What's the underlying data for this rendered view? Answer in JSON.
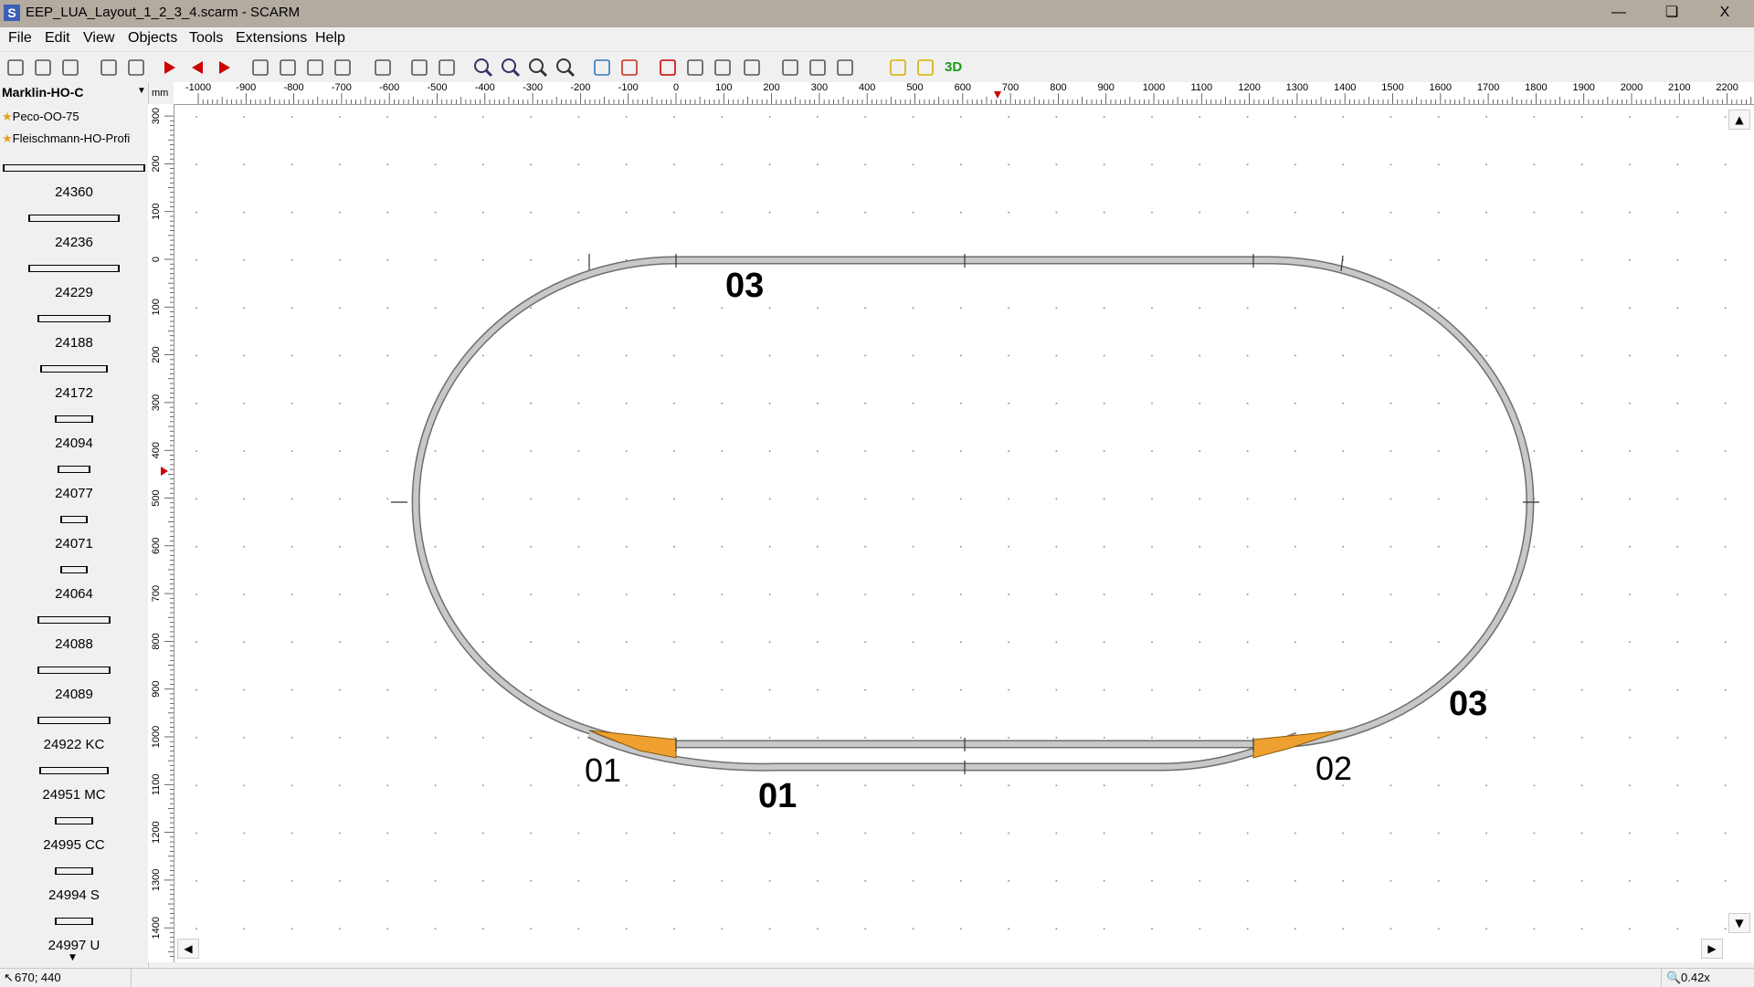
{
  "window": {
    "title": "EEP_LUA_Layout_1_2_3_4.scarm - SCARM",
    "app_icon": "S",
    "minimize": "—",
    "restore": "❏",
    "close": "X"
  },
  "menu": [
    "File",
    "Edit",
    "View",
    "Objects",
    "Tools",
    "Extensions",
    "Help"
  ],
  "toolbar": {
    "icons": [
      "new-file",
      "open-folder",
      "save",
      "print",
      "print-preview",
      "run-forward",
      "run-back",
      "run-step",
      "cut",
      "copy",
      "paste",
      "delete",
      "rotate",
      "undo",
      "redo",
      "zoom-in",
      "zoom-out",
      "zoom-fit",
      "zoom-1-1",
      "background",
      "layers",
      "measure",
      "flex-track",
      "track-join",
      "signal",
      "tunnel",
      "bridge",
      "line-options",
      "object-box",
      "object-measure",
      "view-3d"
    ],
    "view3d_label": "3D"
  },
  "library": {
    "selected": "Marklin-HO-C",
    "favorites": [
      "Peco-OO-75",
      "Fleischmann-HO-Profi"
    ],
    "items": [
      "24360",
      "24236",
      "24229",
      "24188",
      "24172",
      "24094",
      "24077",
      "24071",
      "24064",
      "24088",
      "24089",
      "24922 KC",
      "24951 MC",
      "24995 CC",
      "24994 S",
      "24997 U"
    ]
  },
  "ruler": {
    "unit": "mm",
    "h_labels": [
      "-1000",
      "-900",
      "-800",
      "-700",
      "-600",
      "-500",
      "-400",
      "-300",
      "-200",
      "-100",
      "0",
      "100",
      "200",
      "300",
      "400",
      "500",
      "600",
      "700",
      "800",
      "900",
      "1000",
      "1100",
      "1200",
      "1300",
      "1400",
      "1500",
      "1600",
      "1700",
      "1800",
      "1900",
      "2000",
      "2100",
      "2200"
    ],
    "v_labels": [
      "300",
      "200",
      "100",
      "0",
      "100",
      "200",
      "300",
      "400",
      "500",
      "600",
      "700",
      "800",
      "900",
      "1000",
      "1100",
      "1200",
      "1300",
      "1400"
    ]
  },
  "layout_labels": {
    "top_left": "03",
    "right_lower": "03",
    "switch_left": "01",
    "bottom_center": "01",
    "switch_right": "02"
  },
  "colors": {
    "track": "#c8c8c8",
    "track_edge": "#6e6e6e",
    "switch": "#f0a030",
    "grid_dot": "#9a9a9a"
  },
  "status": {
    "coords": "670; 440",
    "zoom": "0.42x"
  }
}
